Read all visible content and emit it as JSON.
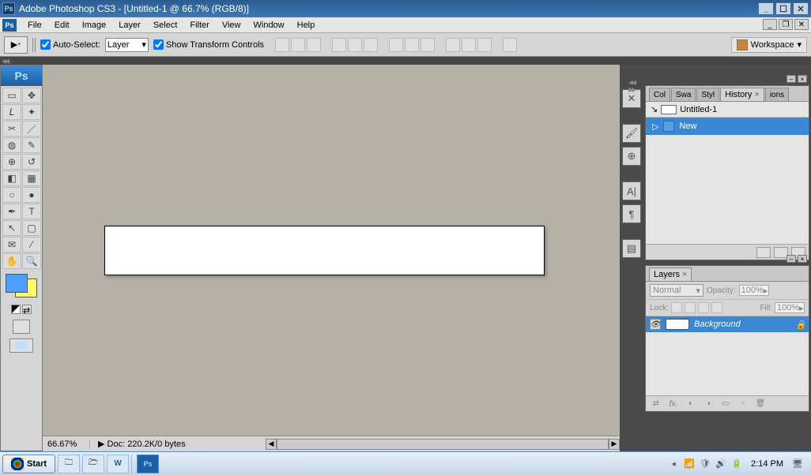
{
  "titlebar": {
    "title": "Adobe Photoshop CS3 - [Untitled-1 @ 66.7% (RGB/8)]"
  },
  "menus": [
    "File",
    "Edit",
    "Image",
    "Layer",
    "Select",
    "Filter",
    "View",
    "Window",
    "Help"
  ],
  "options": {
    "autoselect_label": "Auto-Select:",
    "autoselect_value": "Layer",
    "showtransform_label": "Show Transform Controls",
    "workspace_label": "Workspace"
  },
  "status": {
    "zoom": "66.67%",
    "doc": "Doc: 220.2K/0 bytes"
  },
  "panels": {
    "history": {
      "tabs": [
        "Col",
        "Swa",
        "Styl",
        "History",
        "ions"
      ],
      "active_tab": 3,
      "doc_title": "Untitled-1",
      "items": [
        {
          "label": "New"
        }
      ]
    },
    "layers": {
      "tab": "Layers",
      "blend_mode": "Normal",
      "opacity_label": "Opacity:",
      "opacity_value": "100%",
      "lock_label": "Lock:",
      "fill_label": "Fill:",
      "fill_value": "100%",
      "rows": [
        {
          "name": "Background"
        }
      ]
    }
  },
  "taskbar": {
    "start": "Start",
    "clock": "2:14 PM"
  },
  "colors": {
    "fg": "#4da0ff",
    "bg": "#ffff66"
  }
}
